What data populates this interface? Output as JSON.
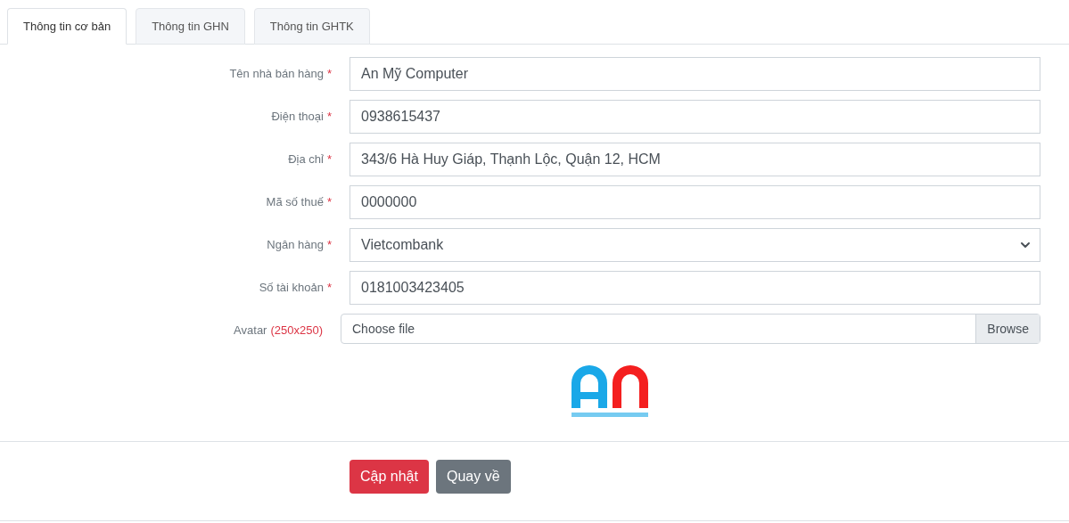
{
  "tabs": [
    {
      "label": "Thông tin cơ bản",
      "selected": true
    },
    {
      "label": "Thông tin GHN",
      "selected": false
    },
    {
      "label": "Thông tin GHTK",
      "selected": false
    }
  ],
  "fields": [
    {
      "kind": "text",
      "label": "Tên nhà bán hàng",
      "required_mark": "*",
      "value": "An Mỹ Computer"
    },
    {
      "kind": "text",
      "label": "Điện thoại",
      "required_mark": "*",
      "value": "0938615437"
    },
    {
      "kind": "text",
      "label": "Địa chỉ",
      "required_mark": "*",
      "value": "343/6 Hà Huy Giáp, Thạnh Lộc, Quận 12, HCM"
    },
    {
      "kind": "text",
      "label": "Mã số thuế",
      "required_mark": "*",
      "value": "0000000"
    },
    {
      "kind": "select",
      "label": "Ngân hàng",
      "required_mark": "*",
      "value": "Vietcombank"
    },
    {
      "kind": "text",
      "label": "Số tài khoản",
      "required_mark": "*",
      "value": "0181003423405"
    },
    {
      "kind": "file",
      "label": "Avatar",
      "hint": "(250x250)",
      "value": "Choose file",
      "browse": "Browse"
    }
  ],
  "buttons": [
    {
      "kind": "danger",
      "label": "Cập nhật"
    },
    {
      "kind": "secondary",
      "label": "Quay về"
    }
  ]
}
